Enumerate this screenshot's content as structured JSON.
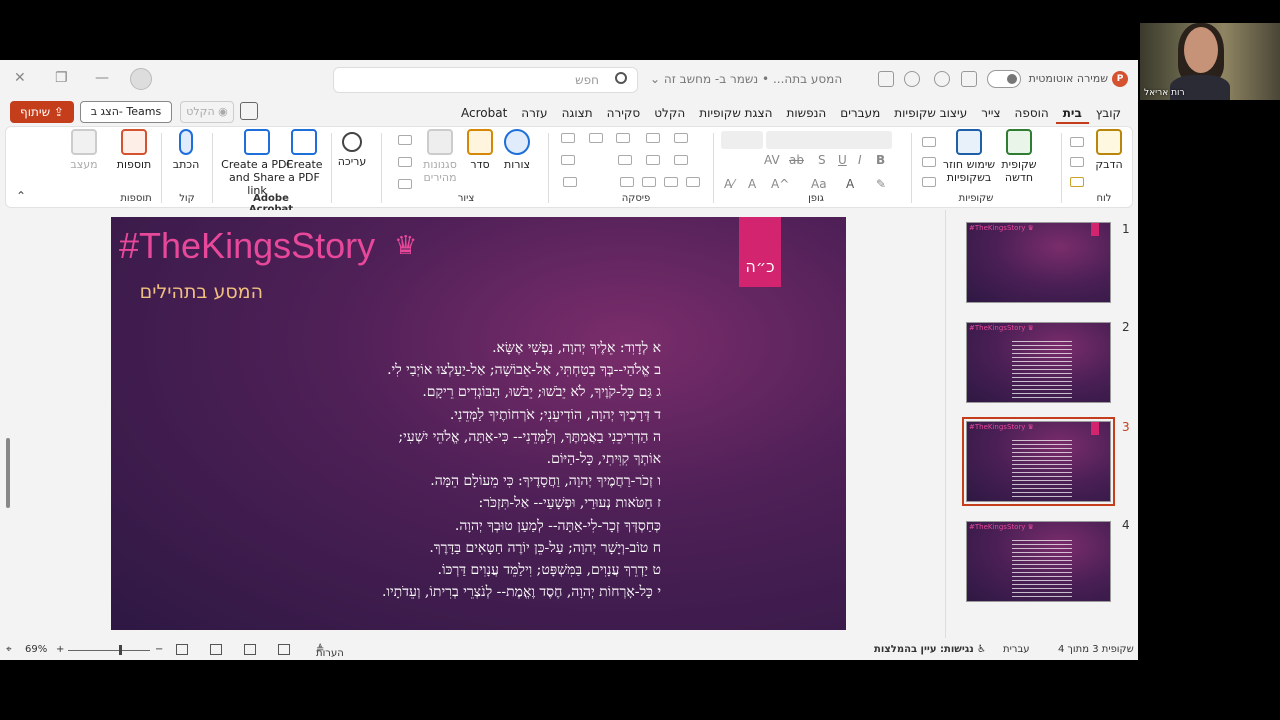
{
  "window": {
    "search_placeholder": "חפש",
    "doc_title": "המסע בתה... • נשמר ב- מחשב זה ⌄",
    "autosave_label": "שמירה אוטומטית"
  },
  "menu": {
    "tabs": [
      "קובץ",
      "בית",
      "הוספה",
      "צייר",
      "עיצוב שקופיות",
      "מעברים",
      "הנפשות",
      "הצגת שקופיות",
      "הקלט",
      "סקירה",
      "תצוגה",
      "עזרה",
      "Acrobat"
    ],
    "share_label": "שיתוף",
    "teams_label": "הצג ב- Teams",
    "record_label": "הקלט"
  },
  "ribbon": {
    "groups": {
      "clipboard": "לוח",
      "slides": "שקופיות",
      "font": "גופן",
      "paragraph": "פיסקה",
      "drawing": "ציור",
      "acrobat": "Adobe Acrobat",
      "voice": "קול",
      "addins": "תוספות"
    },
    "buttons": {
      "paste": "הדבק",
      "new_slide_1": "שקופית",
      "new_slide_2": "חדשה",
      "reuse_1": "שימוש חוזר",
      "reuse_2": "בשקופיות",
      "shapes": "צורות",
      "arrange": "סדר",
      "quick_styles_1": "סגנונות",
      "quick_styles_2": "מהירים",
      "editing": "עריכה",
      "pdf_share_1": "Create a PDF",
      "pdf_share_2": "and Share link",
      "pdf_1": "Create",
      "pdf_2": "a PDF",
      "dictate": "הכתב",
      "addins": "תוספות",
      "designer": "מעצב"
    }
  },
  "slide": {
    "title": "#TheKingsStory",
    "crown": "♛",
    "subtitle": "המסע בתהילים",
    "tag": "כ״ה",
    "verses": [
      "א  לְדָוִד:    אֵלֶיךָ יְהוָה, נַפְשִׁי אֶשָּׂא.",
      "ב  אֱלֹהַי--בְּךָ בָטַחְתִּי, אַל-אֵבוֹשָׁה;    אַל-יַעַלְצוּ אוֹיְבַי לִי.",
      "ג  גַּם כָּל-קֹוֶיךָ, לֹא יֵבֹשׁוּ;    יֵבֹשׁוּ, הַבּוֹגְדִים רֵיקָם.",
      "ד  דְּרָכֶיךָ יְהוָה, הוֹדִיעֵנִי;    אֹרְחוֹתֶיךָ לַמְּדֵנִי.",
      "ה  הַדְרִיכֵנִי בַאֲמִתֶּךָ, וְלַמְּדֵנִי--    כִּי-אַתָּה, אֱלֹהֵי יִשְׁעִי;",
      "אוֹתְךָ קִוִּיתִי,    כָּל-הַיּוֹם.",
      "ו  זְכֹר-רַחֲמֶיךָ יְהוָה, וַחֲסָדֶיךָ:    כִּי מֵעוֹלָם הֵמָּה.",
      "ז  חַטֹּאות נְעוּרַי, וּפְשָׁעַי--    אַל-תִּזְכֹּר:",
      "כְּחַסְדְּךָ זְכָר-לִי-אַתָּה--    לְמַעַן טוּבְךָ יְהוָה.",
      "ח  טוֹב-וְיָשָׁר יְהוָה;    עַל-כֵּן יוֹרֶה חַטָּאִים בַּדָּרֶךְ.",
      "ט  יַדְרֵךְ עֲנָוִים, בַּמִּשְׁפָּט;    וִילַמֵּד עֲנָוִים דַּרְכּוֹ.",
      "י  כָּל-אָרְחוֹת יְהוָה, חֶסֶד וֶאֱמֶת--    לְנֹצְרֵי בְרִיתוֹ, וְעֵדֹתָיו."
    ]
  },
  "thumbnails": [
    {
      "number": "1",
      "title": "#TheKingsStory ♛"
    },
    {
      "number": "2",
      "title": "#TheKingsStory ♛"
    },
    {
      "number": "3",
      "title": "#TheKingsStory ♛"
    },
    {
      "number": "4",
      "title": "#TheKingsStory ♛"
    }
  ],
  "status": {
    "slide_count": "שקופית 3 מתוך 4",
    "language": "עברית",
    "accessibility": "נגישות: עיין בהמלצות",
    "notes": "הערות",
    "zoom": "69%"
  },
  "webcam": {
    "name": "רות אריאל"
  },
  "colors": {
    "accent": "#c43e1c",
    "slide_title": "#e8489a",
    "slide_tag": "#d3246f"
  }
}
